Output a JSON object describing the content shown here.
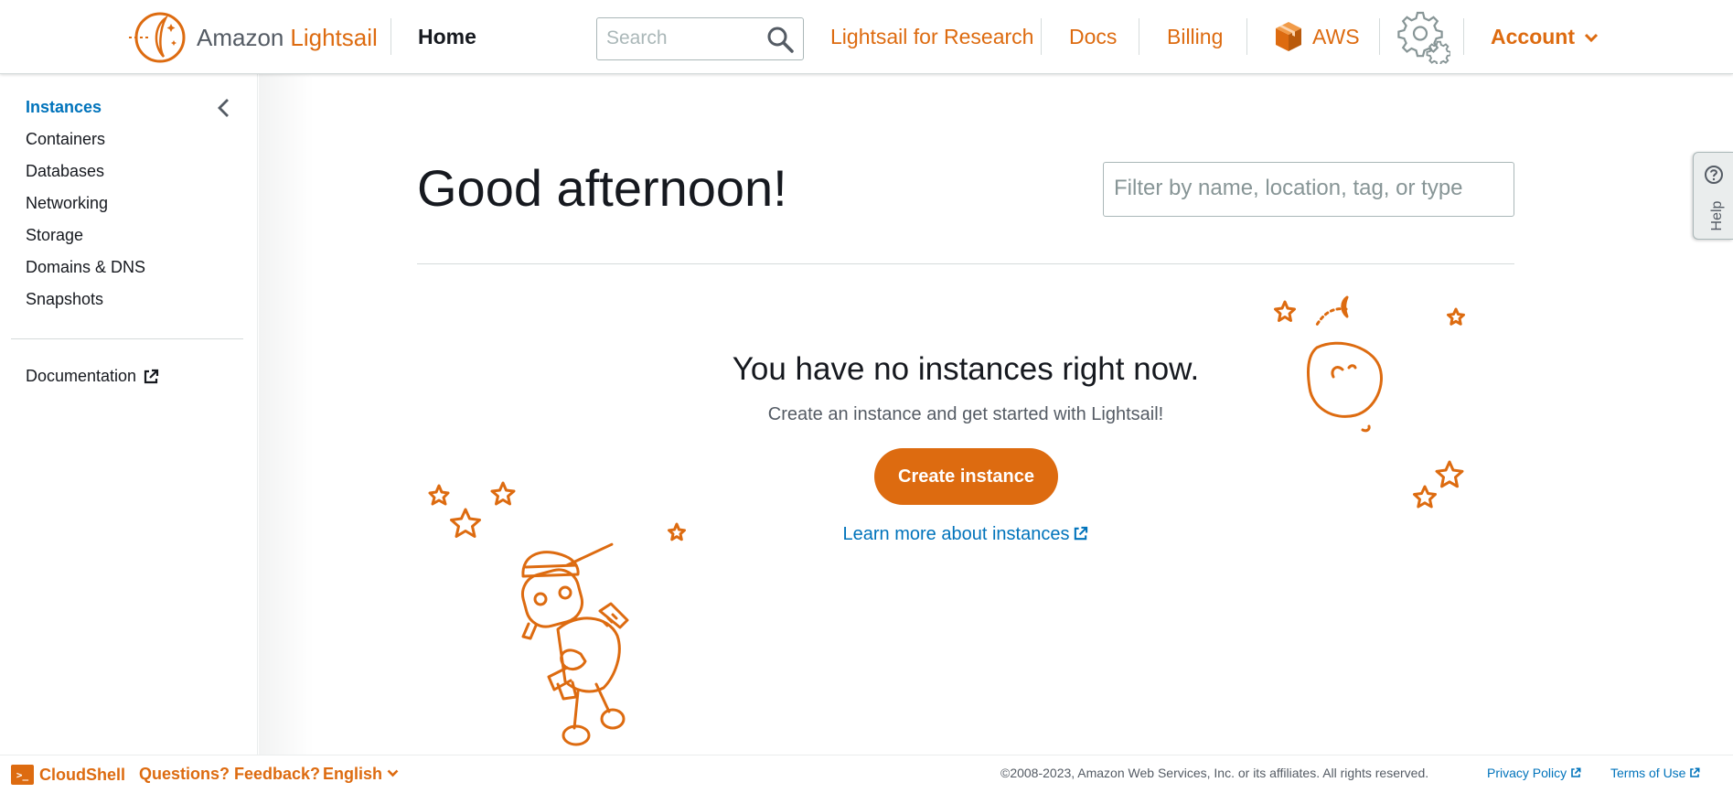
{
  "header": {
    "brand_prefix": "Amazon",
    "brand_name": "Lightsail",
    "home": "Home",
    "search_placeholder": "Search",
    "links": {
      "research": "Lightsail for Research",
      "docs": "Docs",
      "billing": "Billing",
      "aws": "AWS"
    },
    "account": "Account"
  },
  "sidebar": {
    "items": [
      {
        "label": "Instances",
        "active": true
      },
      {
        "label": "Containers"
      },
      {
        "label": "Databases"
      },
      {
        "label": "Networking"
      },
      {
        "label": "Storage"
      },
      {
        "label": "Domains & DNS"
      },
      {
        "label": "Snapshots"
      }
    ],
    "documentation": "Documentation"
  },
  "main": {
    "greeting": "Good afternoon!",
    "filter_placeholder": "Filter by name, location, tag, or type",
    "empty_title": "You have no instances right now.",
    "empty_subtitle": "Create an instance and get started with Lightsail!",
    "create_button": "Create instance",
    "learn_more": "Learn more about instances"
  },
  "help_tab": "Help",
  "footer": {
    "cloudshell": "CloudShell",
    "feedback": "Questions? Feedback?",
    "language": "English",
    "copyright": "©2008-2023, Amazon Web Services, Inc. or its affiliates. All rights reserved.",
    "privacy": "Privacy Policy",
    "terms": "Terms of Use"
  },
  "colors": {
    "accent": "#dd6b10",
    "link": "#0073bb",
    "text": "#16191f"
  }
}
